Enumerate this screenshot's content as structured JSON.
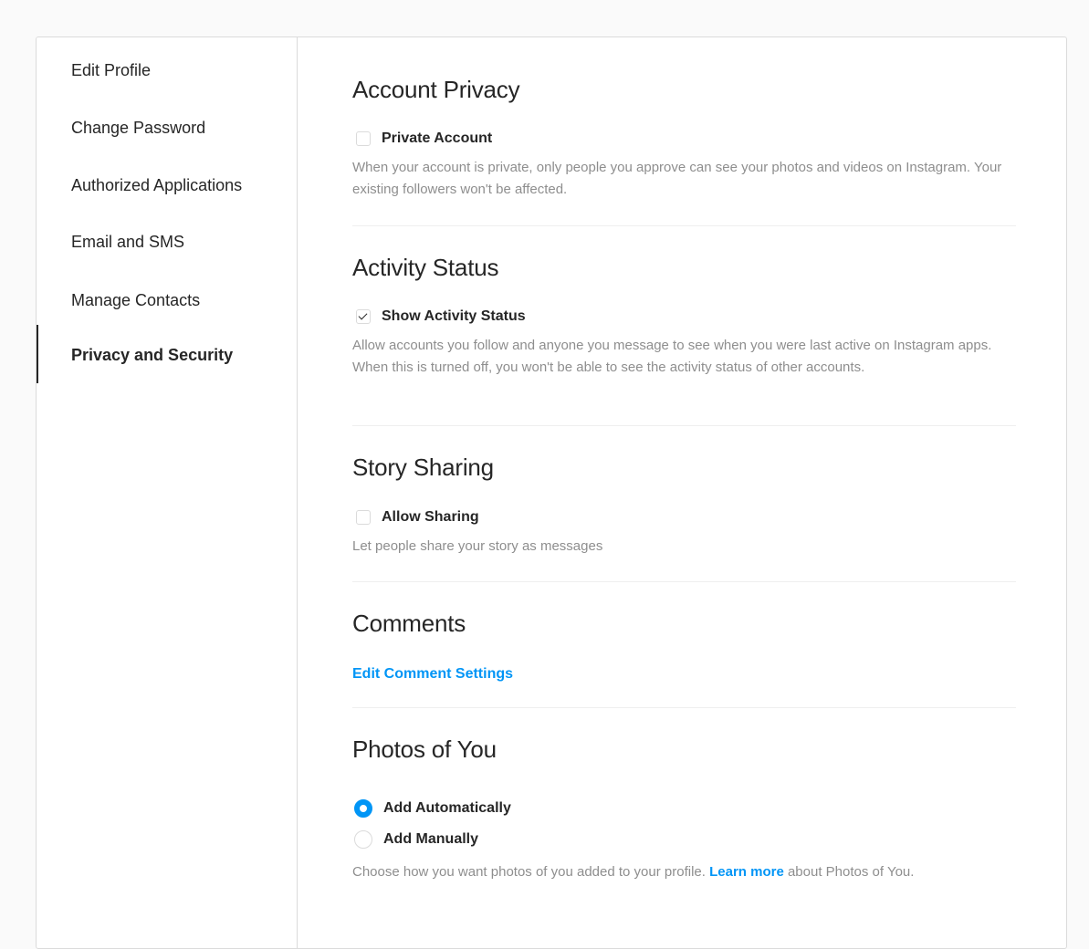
{
  "sidebar": {
    "items": [
      {
        "label": "Edit Profile",
        "active": false
      },
      {
        "label": "Change Password",
        "active": false
      },
      {
        "label": "Authorized Applications",
        "active": false
      },
      {
        "label": "Email and SMS",
        "active": false
      },
      {
        "label": "Manage Contacts",
        "active": false
      },
      {
        "label": "Privacy and Security",
        "active": true
      }
    ]
  },
  "account_privacy": {
    "title": "Account Privacy",
    "checkbox_label": "Private Account",
    "checked": false,
    "description": "When your account is private, only people you approve can see your photos and videos on Instagram. Your existing followers won't be affected."
  },
  "activity_status": {
    "title": "Activity Status",
    "checkbox_label": "Show Activity Status",
    "checked": true,
    "description": "Allow accounts you follow and anyone you message to see when you were last active on Instagram apps. When this is turned off, you won't be able to see the activity status of other accounts."
  },
  "story_sharing": {
    "title": "Story Sharing",
    "checkbox_label": "Allow Sharing",
    "checked": false,
    "description": "Let people share your story as messages"
  },
  "comments": {
    "title": "Comments",
    "link_label": "Edit Comment Settings"
  },
  "photos_of_you": {
    "title": "Photos of You",
    "options": [
      {
        "label": "Add Automatically",
        "selected": true
      },
      {
        "label": "Add Manually",
        "selected": false
      }
    ],
    "description_before": "Choose how you want photos of you added to your profile. ",
    "learn_more": "Learn more",
    "description_after": " about Photos of You."
  },
  "colors": {
    "accent": "#0095f6",
    "text": "#262626",
    "secondary_text": "#8e8e8e",
    "border": "#dbdbdb"
  }
}
